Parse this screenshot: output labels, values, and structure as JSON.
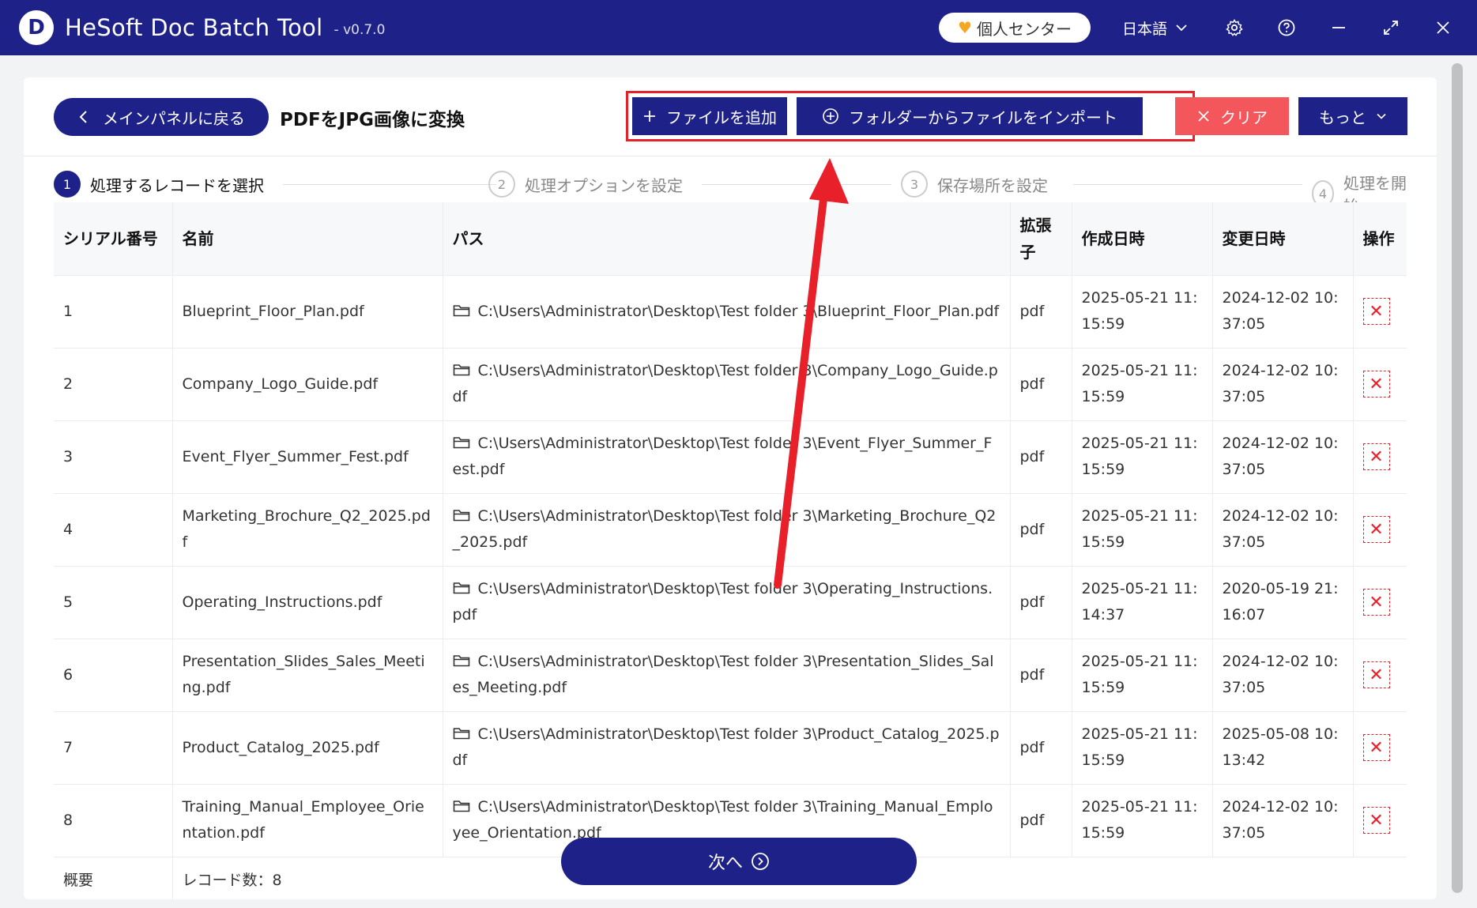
{
  "titlebar": {
    "logo_letter": "D",
    "app_title": "HeSoft Doc Batch Tool",
    "version": "- v0.7.0",
    "personal_center": "個人センター",
    "language": "日本語"
  },
  "toolbar": {
    "back_label": "メインパネルに戻る",
    "page_title": "PDFをJPG画像に変換",
    "add_file": "ファイルを追加",
    "import_folder": "フォルダーからファイルをインポート",
    "clear": "クリア",
    "more": "もっと"
  },
  "steps": [
    {
      "num": "1",
      "label": "処理するレコードを選択"
    },
    {
      "num": "2",
      "label": "処理オプションを設定"
    },
    {
      "num": "3",
      "label": "保存場所を設定"
    },
    {
      "num": "4",
      "label": "処理を開始"
    }
  ],
  "table": {
    "headers": [
      "シリアル番号",
      "名前",
      "パス",
      "拡張子",
      "作成日時",
      "変更日時",
      "操作"
    ],
    "rows": [
      {
        "no": "1",
        "name": "Blueprint_Floor_Plan.pdf",
        "path": "C:\\Users\\Administrator\\Desktop\\Test folder 3\\Blueprint_Floor_Plan.pdf",
        "ext": "pdf",
        "created": "2025-05-21 11:15:59",
        "modified": "2024-12-02 10:37:05"
      },
      {
        "no": "2",
        "name": "Company_Logo_Guide.pdf",
        "path": "C:\\Users\\Administrator\\Desktop\\Test folder 3\\Company_Logo_Guide.pdf",
        "ext": "pdf",
        "created": "2025-05-21 11:15:59",
        "modified": "2024-12-02 10:37:05"
      },
      {
        "no": "3",
        "name": "Event_Flyer_Summer_Fest.pdf",
        "path": "C:\\Users\\Administrator\\Desktop\\Test folder 3\\Event_Flyer_Summer_Fest.pdf",
        "ext": "pdf",
        "created": "2025-05-21 11:15:59",
        "modified": "2024-12-02 10:37:05"
      },
      {
        "no": "4",
        "name": "Marketing_Brochure_Q2_2025.pdf",
        "path": "C:\\Users\\Administrator\\Desktop\\Test folder 3\\Marketing_Brochure_Q2_2025.pdf",
        "ext": "pdf",
        "created": "2025-05-21 11:15:59",
        "modified": "2024-12-02 10:37:05"
      },
      {
        "no": "5",
        "name": "Operating_Instructions.pdf",
        "path": "C:\\Users\\Administrator\\Desktop\\Test folder 3\\Operating_Instructions.pdf",
        "ext": "pdf",
        "created": "2025-05-21 11:14:37",
        "modified": "2020-05-19 21:16:07"
      },
      {
        "no": "6",
        "name": "Presentation_Slides_Sales_Meeting.pdf",
        "path": "C:\\Users\\Administrator\\Desktop\\Test folder 3\\Presentation_Slides_Sales_Meeting.pdf",
        "ext": "pdf",
        "created": "2025-05-21 11:15:59",
        "modified": "2024-12-02 10:37:05"
      },
      {
        "no": "7",
        "name": "Product_Catalog_2025.pdf",
        "path": "C:\\Users\\Administrator\\Desktop\\Test folder 3\\Product_Catalog_2025.pdf",
        "ext": "pdf",
        "created": "2025-05-21 11:15:59",
        "modified": "2025-05-08 10:13:42"
      },
      {
        "no": "8",
        "name": "Training_Manual_Employee_Orientation.pdf",
        "path": "C:\\Users\\Administrator\\Desktop\\Test folder 3\\Training_Manual_Employee_Orientation.pdf",
        "ext": "pdf",
        "created": "2025-05-21 11:15:59",
        "modified": "2024-12-02 10:37:05"
      }
    ],
    "summary_label": "概要",
    "summary_value": "レコード数：8"
  },
  "next_label": "次へ",
  "colors": {
    "brand": "#1d2188",
    "danger": "#f4575b",
    "highlight": "#e8202a"
  },
  "icons": {
    "back": "chevron-left-icon",
    "add": "plus-icon",
    "import": "plus-circle-icon",
    "clear": "close-icon",
    "more": "chevron-down-icon",
    "settings": "gear-icon",
    "help": "help-icon",
    "minimize": "minimize-icon",
    "maximize": "maximize-icon",
    "close": "close-icon",
    "folder": "folder-icon",
    "delete": "delete-icon",
    "next": "arrow-right-circle-icon"
  }
}
